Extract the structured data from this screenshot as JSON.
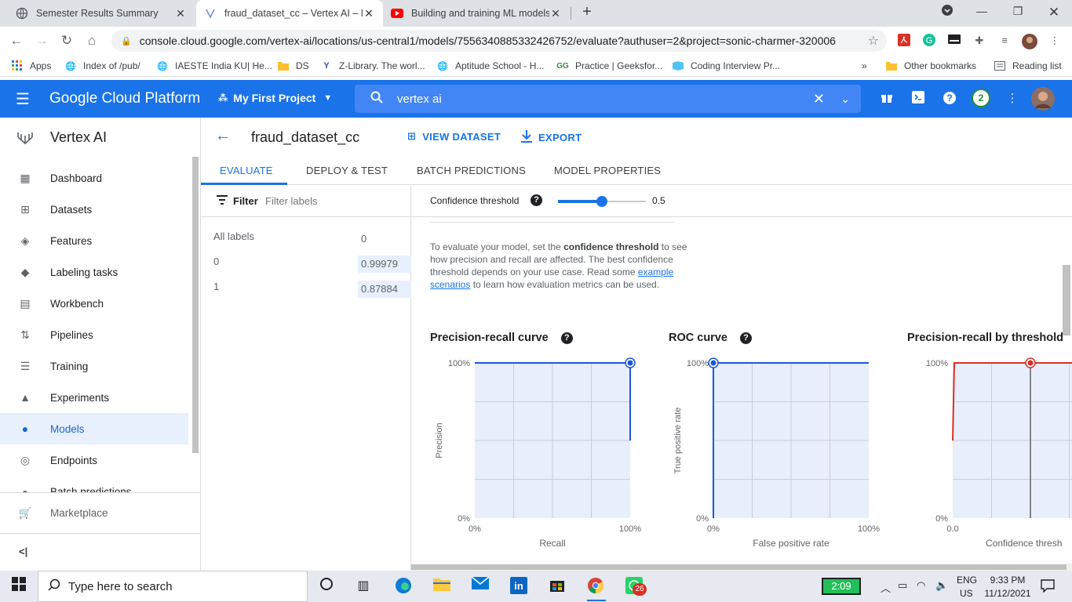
{
  "browser": {
    "tabs": [
      {
        "title": "Semester Results Summary",
        "icon": "globe-icon"
      },
      {
        "title": "fraud_dataset_cc – Vertex AI – My",
        "icon": "vertex-icon"
      },
      {
        "title": "Building and training ML models",
        "icon": "youtube-icon"
      }
    ],
    "new_tab": "+",
    "url": "console.cloud.google.com/vertex-ai/locations/us-central1/models/7556340885332426752/evaluate?authuser=2&project=sonic-charmer-320006",
    "bookmarks": [
      "Apps",
      "Index of /pub/",
      "IAESTE India KU| He...",
      "DS",
      "Z-Library. The worl...",
      "Aptitude School - H...",
      "Practice | Geeksfor...",
      "Coding Interview Pr..."
    ],
    "other_bookmarks": "Other bookmarks",
    "reading_list": "Reading list",
    "more": "»"
  },
  "gcp": {
    "brand": "Google Cloud Platform",
    "project": "My First Project",
    "search_value": "vertex ai",
    "notifications": "2"
  },
  "sidebar": {
    "product": "Vertex AI",
    "items": [
      {
        "label": "Dashboard",
        "icon": "dashboard-icon"
      },
      {
        "label": "Datasets",
        "icon": "datasets-icon"
      },
      {
        "label": "Features",
        "icon": "features-icon"
      },
      {
        "label": "Labeling tasks",
        "icon": "label-icon"
      },
      {
        "label": "Workbench",
        "icon": "workbench-icon"
      },
      {
        "label": "Pipelines",
        "icon": "pipelines-icon"
      },
      {
        "label": "Training",
        "icon": "training-icon"
      },
      {
        "label": "Experiments",
        "icon": "experiments-icon"
      },
      {
        "label": "Models",
        "icon": "models-icon"
      },
      {
        "label": "Endpoints",
        "icon": "endpoints-icon"
      },
      {
        "label": "Batch predictions",
        "icon": "batch-icon"
      }
    ],
    "active": "Models",
    "marketplace": "Marketplace",
    "collapse": "<|"
  },
  "main": {
    "title": "fraud_dataset_cc",
    "view_dataset": "VIEW DATASET",
    "export": "EXPORT",
    "tabs": [
      "EVALUATE",
      "DEPLOY & TEST",
      "BATCH PREDICTIONS",
      "MODEL PROPERTIES"
    ],
    "active_tab": "EVALUATE"
  },
  "labels_panel": {
    "filter_label": "Filter",
    "filter_placeholder": "Filter labels",
    "rows": [
      {
        "label": "All labels",
        "value": "0"
      },
      {
        "label": "0",
        "value": "0.99979"
      },
      {
        "label": "1",
        "value": "0.87884"
      }
    ]
  },
  "evaluate": {
    "confidence_label": "Confidence threshold",
    "confidence_value": "0.5",
    "confidence_fraction": 0.5,
    "description_pre": "To evaluate your model, set the",
    "description_bold": "confidence threshold",
    "description_mid": "to see how precision and recall are affected. The best confidence threshold depends on your use case. Read some",
    "description_link": "example scenarios",
    "description_post": "to learn how evaluation metrics can be used."
  },
  "chart_data": [
    {
      "type": "line",
      "title": "Precision-recall curve",
      "xlabel": "Recall",
      "ylabel": "Precision",
      "xticks": [
        "0%",
        "100%"
      ],
      "yticks": [
        "0%",
        "100%"
      ],
      "xlim": [
        0,
        1
      ],
      "ylim": [
        0,
        1
      ],
      "grid": true,
      "x": [
        0.0,
        0.999,
        1.0,
        1.0
      ],
      "y": [
        1.0,
        1.0,
        1.0,
        0.5
      ],
      "marker": {
        "x": 1.0,
        "y": 1.0
      },
      "color": "#1a56db"
    },
    {
      "type": "line",
      "title": "ROC curve",
      "xlabel": "False positive rate",
      "ylabel": "True positive rate",
      "xticks": [
        "0%",
        "100%"
      ],
      "yticks": [
        "0%",
        "100%"
      ],
      "xlim": [
        0,
        1
      ],
      "ylim": [
        0,
        1
      ],
      "grid": true,
      "x": [
        0.0,
        0.0,
        1.0
      ],
      "y": [
        0.0,
        1.0,
        1.0
      ],
      "marker": {
        "x": 0.0,
        "y": 1.0
      },
      "color": "#1a56db"
    },
    {
      "type": "line",
      "title": "Precision-recall by threshold",
      "xlabel": "Confidence thresh",
      "ylabel": "",
      "xticks": [
        "0.0"
      ],
      "yticks": [
        "0%",
        "100%"
      ],
      "xlim": [
        0,
        1
      ],
      "ylim": [
        0,
        1
      ],
      "grid": true,
      "x": [
        0.0,
        0.0,
        0.01,
        1.0
      ],
      "y": [
        0.5,
        0.5,
        1.0,
        1.0
      ],
      "marker": {
        "x": 0.5,
        "y": 1.0
      },
      "threshold_line": 0.5,
      "color": "#d93025"
    }
  ],
  "taskbar": {
    "search_placeholder": "Type here to search",
    "battery": "2:09",
    "lang_top": "ENG",
    "lang_bottom": "US",
    "time": "9:33 PM",
    "date": "11/12/2021",
    "whatsapp_badge": "26"
  }
}
